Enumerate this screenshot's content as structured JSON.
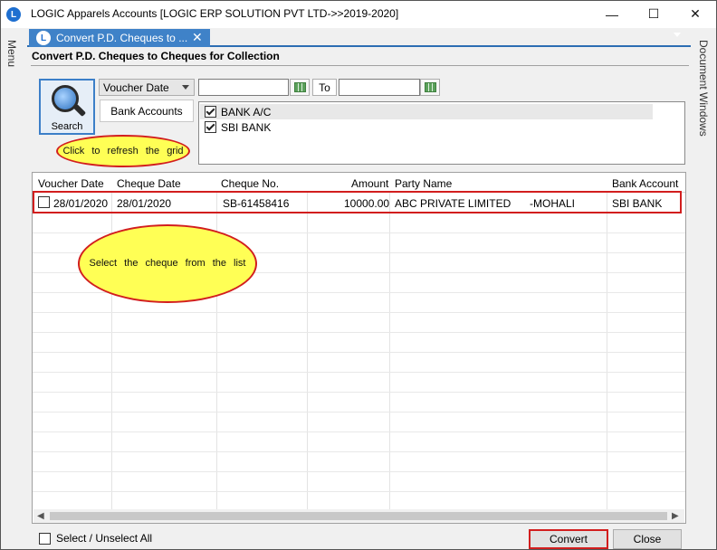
{
  "window": {
    "icon_letter": "L",
    "title": "LOGIC Apparels Accounts  [LOGIC ERP SOLUTION PVT LTD->>2019-2020]",
    "minimize": "—",
    "maximize": "☐",
    "close": "✕"
  },
  "rails": {
    "menu": "Menu",
    "document_windows": "Document Windows"
  },
  "tab": {
    "label": "Convert P.D. Cheques to ...",
    "close": "✕"
  },
  "form": {
    "title": "Convert P.D. Cheques to Cheques for Collection"
  },
  "filters": {
    "search_label": "Search",
    "date_type": "Voucher Date",
    "date_from": "",
    "to_label": "To",
    "date_to": "",
    "bank_accounts_label": "Bank Accounts",
    "banks": [
      {
        "name": "BANK A/C",
        "checked": true
      },
      {
        "name": "SBI BANK",
        "checked": true
      }
    ]
  },
  "callouts": {
    "refresh": "Click to refresh the grid",
    "select": "Select the cheque from the list"
  },
  "grid": {
    "columns": [
      "Voucher Date",
      "Cheque Date",
      "Cheque No.",
      "Amount",
      "Party Name",
      "Bank Account"
    ],
    "rows": [
      {
        "checked": false,
        "voucher_date": "28/01/2020",
        "cheque_date": "28/01/2020",
        "cheque_no": "SB-61458416",
        "amount": "10000.00",
        "party_name": "ABC PRIVATE LIMITED",
        "party_city": "-MOHALI",
        "bank_account": "SBI BANK"
      }
    ]
  },
  "footer": {
    "select_all_label": "Select / Unselect All",
    "convert_label": "Convert",
    "close_label": "Close"
  },
  "colors": {
    "accent": "#3f82c8",
    "highlight_border": "#d21e1e",
    "callout_fill": "#ffff55"
  }
}
